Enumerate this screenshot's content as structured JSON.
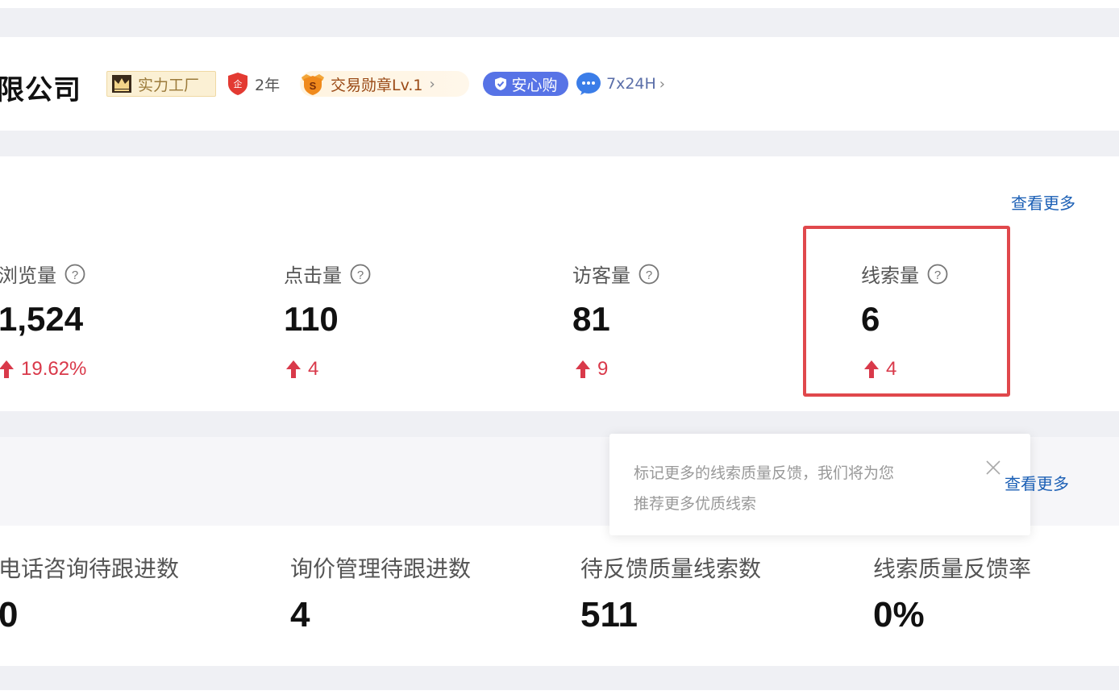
{
  "header": {
    "company_name": "限公司",
    "badges": {
      "factory": "实力工厂",
      "years": "2年",
      "medal": "交易勋章Lv.1",
      "anxin": "安心购",
      "service": "7x24H"
    }
  },
  "stats": {
    "see_more": "查看更多",
    "items": [
      {
        "label": "浏览量",
        "value": "1,524",
        "change": "19.62%"
      },
      {
        "label": "点击量",
        "value": "110",
        "change": "4"
      },
      {
        "label": "访客量",
        "value": "81",
        "change": "9"
      },
      {
        "label": "线索量",
        "value": "6",
        "change": "4"
      }
    ]
  },
  "leads": {
    "see_more": "查看更多",
    "tooltip": {
      "line1": "标记更多的线索质量反馈，我们将为您",
      "line2": "推荐更多优质线索"
    },
    "items": [
      {
        "label": "电话咨询待跟进数",
        "value": "0"
      },
      {
        "label": "询价管理待跟进数",
        "value": "4"
      },
      {
        "label": "待反馈质量线索数",
        "value": "511"
      },
      {
        "label": "线索质量反馈率",
        "value": "0%"
      }
    ]
  },
  "colors": {
    "accent_link": "#1b5fb5",
    "increase_red": "#d9394a",
    "highlight_border": "#e0484c",
    "anxin_blue": "#5773e6"
  },
  "icons": [
    "crown-icon",
    "shield-icon",
    "medal-icon",
    "check-icon",
    "chat-icon",
    "chevron-right-icon",
    "help-icon",
    "arrow-up-icon",
    "close-icon"
  ]
}
